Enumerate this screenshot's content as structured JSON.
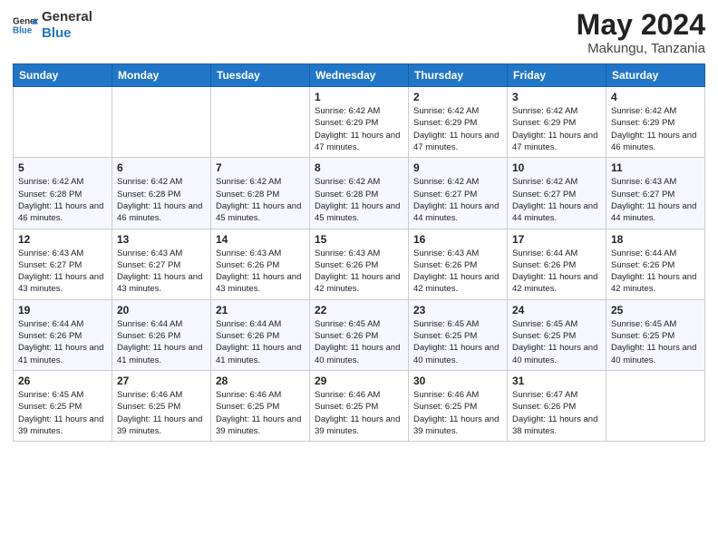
{
  "logo": {
    "line1": "General",
    "line2": "Blue"
  },
  "title": "May 2024",
  "subtitle": "Makungu, Tanzania",
  "days_of_week": [
    "Sunday",
    "Monday",
    "Tuesday",
    "Wednesday",
    "Thursday",
    "Friday",
    "Saturday"
  ],
  "weeks": [
    [
      {
        "day": "",
        "sunrise": "",
        "sunset": "",
        "daylight": ""
      },
      {
        "day": "",
        "sunrise": "",
        "sunset": "",
        "daylight": ""
      },
      {
        "day": "",
        "sunrise": "",
        "sunset": "",
        "daylight": ""
      },
      {
        "day": "1",
        "sunrise": "Sunrise: 6:42 AM",
        "sunset": "Sunset: 6:29 PM",
        "daylight": "Daylight: 11 hours and 47 minutes."
      },
      {
        "day": "2",
        "sunrise": "Sunrise: 6:42 AM",
        "sunset": "Sunset: 6:29 PM",
        "daylight": "Daylight: 11 hours and 47 minutes."
      },
      {
        "day": "3",
        "sunrise": "Sunrise: 6:42 AM",
        "sunset": "Sunset: 6:29 PM",
        "daylight": "Daylight: 11 hours and 47 minutes."
      },
      {
        "day": "4",
        "sunrise": "Sunrise: 6:42 AM",
        "sunset": "Sunset: 6:29 PM",
        "daylight": "Daylight: 11 hours and 46 minutes."
      }
    ],
    [
      {
        "day": "5",
        "sunrise": "Sunrise: 6:42 AM",
        "sunset": "Sunset: 6:28 PM",
        "daylight": "Daylight: 11 hours and 46 minutes."
      },
      {
        "day": "6",
        "sunrise": "Sunrise: 6:42 AM",
        "sunset": "Sunset: 6:28 PM",
        "daylight": "Daylight: 11 hours and 46 minutes."
      },
      {
        "day": "7",
        "sunrise": "Sunrise: 6:42 AM",
        "sunset": "Sunset: 6:28 PM",
        "daylight": "Daylight: 11 hours and 45 minutes."
      },
      {
        "day": "8",
        "sunrise": "Sunrise: 6:42 AM",
        "sunset": "Sunset: 6:28 PM",
        "daylight": "Daylight: 11 hours and 45 minutes."
      },
      {
        "day": "9",
        "sunrise": "Sunrise: 6:42 AM",
        "sunset": "Sunset: 6:27 PM",
        "daylight": "Daylight: 11 hours and 44 minutes."
      },
      {
        "day": "10",
        "sunrise": "Sunrise: 6:42 AM",
        "sunset": "Sunset: 6:27 PM",
        "daylight": "Daylight: 11 hours and 44 minutes."
      },
      {
        "day": "11",
        "sunrise": "Sunrise: 6:43 AM",
        "sunset": "Sunset: 6:27 PM",
        "daylight": "Daylight: 11 hours and 44 minutes."
      }
    ],
    [
      {
        "day": "12",
        "sunrise": "Sunrise: 6:43 AM",
        "sunset": "Sunset: 6:27 PM",
        "daylight": "Daylight: 11 hours and 43 minutes."
      },
      {
        "day": "13",
        "sunrise": "Sunrise: 6:43 AM",
        "sunset": "Sunset: 6:27 PM",
        "daylight": "Daylight: 11 hours and 43 minutes."
      },
      {
        "day": "14",
        "sunrise": "Sunrise: 6:43 AM",
        "sunset": "Sunset: 6:26 PM",
        "daylight": "Daylight: 11 hours and 43 minutes."
      },
      {
        "day": "15",
        "sunrise": "Sunrise: 6:43 AM",
        "sunset": "Sunset: 6:26 PM",
        "daylight": "Daylight: 11 hours and 42 minutes."
      },
      {
        "day": "16",
        "sunrise": "Sunrise: 6:43 AM",
        "sunset": "Sunset: 6:26 PM",
        "daylight": "Daylight: 11 hours and 42 minutes."
      },
      {
        "day": "17",
        "sunrise": "Sunrise: 6:44 AM",
        "sunset": "Sunset: 6:26 PM",
        "daylight": "Daylight: 11 hours and 42 minutes."
      },
      {
        "day": "18",
        "sunrise": "Sunrise: 6:44 AM",
        "sunset": "Sunset: 6:26 PM",
        "daylight": "Daylight: 11 hours and 42 minutes."
      }
    ],
    [
      {
        "day": "19",
        "sunrise": "Sunrise: 6:44 AM",
        "sunset": "Sunset: 6:26 PM",
        "daylight": "Daylight: 11 hours and 41 minutes."
      },
      {
        "day": "20",
        "sunrise": "Sunrise: 6:44 AM",
        "sunset": "Sunset: 6:26 PM",
        "daylight": "Daylight: 11 hours and 41 minutes."
      },
      {
        "day": "21",
        "sunrise": "Sunrise: 6:44 AM",
        "sunset": "Sunset: 6:26 PM",
        "daylight": "Daylight: 11 hours and 41 minutes."
      },
      {
        "day": "22",
        "sunrise": "Sunrise: 6:45 AM",
        "sunset": "Sunset: 6:26 PM",
        "daylight": "Daylight: 11 hours and 40 minutes."
      },
      {
        "day": "23",
        "sunrise": "Sunrise: 6:45 AM",
        "sunset": "Sunset: 6:25 PM",
        "daylight": "Daylight: 11 hours and 40 minutes."
      },
      {
        "day": "24",
        "sunrise": "Sunrise: 6:45 AM",
        "sunset": "Sunset: 6:25 PM",
        "daylight": "Daylight: 11 hours and 40 minutes."
      },
      {
        "day": "25",
        "sunrise": "Sunrise: 6:45 AM",
        "sunset": "Sunset: 6:25 PM",
        "daylight": "Daylight: 11 hours and 40 minutes."
      }
    ],
    [
      {
        "day": "26",
        "sunrise": "Sunrise: 6:45 AM",
        "sunset": "Sunset: 6:25 PM",
        "daylight": "Daylight: 11 hours and 39 minutes."
      },
      {
        "day": "27",
        "sunrise": "Sunrise: 6:46 AM",
        "sunset": "Sunset: 6:25 PM",
        "daylight": "Daylight: 11 hours and 39 minutes."
      },
      {
        "day": "28",
        "sunrise": "Sunrise: 6:46 AM",
        "sunset": "Sunset: 6:25 PM",
        "daylight": "Daylight: 11 hours and 39 minutes."
      },
      {
        "day": "29",
        "sunrise": "Sunrise: 6:46 AM",
        "sunset": "Sunset: 6:25 PM",
        "daylight": "Daylight: 11 hours and 39 minutes."
      },
      {
        "day": "30",
        "sunrise": "Sunrise: 6:46 AM",
        "sunset": "Sunset: 6:25 PM",
        "daylight": "Daylight: 11 hours and 39 minutes."
      },
      {
        "day": "31",
        "sunrise": "Sunrise: 6:47 AM",
        "sunset": "Sunset: 6:26 PM",
        "daylight": "Daylight: 11 hours and 38 minutes."
      },
      {
        "day": "",
        "sunrise": "",
        "sunset": "",
        "daylight": ""
      }
    ]
  ]
}
